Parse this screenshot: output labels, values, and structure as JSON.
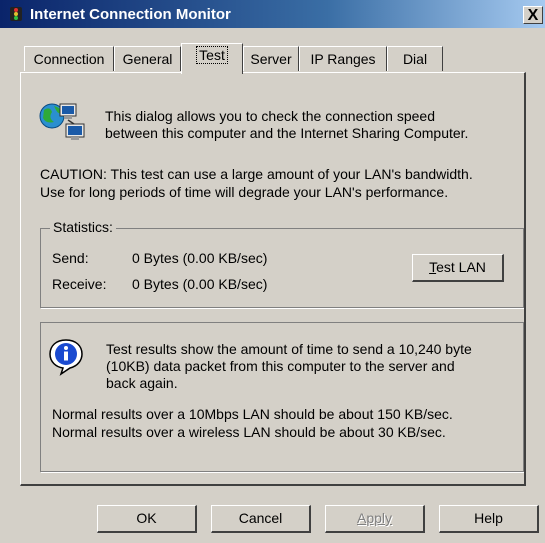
{
  "window": {
    "title": "Internet Connection Monitor",
    "close_glyph": "X"
  },
  "tabs": [
    {
      "label": "Connection",
      "active": false
    },
    {
      "label": "General",
      "active": false
    },
    {
      "label": "Test",
      "active": true
    },
    {
      "label": "Server",
      "active": false
    },
    {
      "label": "IP Ranges",
      "active": false
    },
    {
      "label": "Dial",
      "active": false
    }
  ],
  "intro": {
    "line1": "This dialog allows you to check the connection speed",
    "line2": "between this computer and the Internet Sharing Computer."
  },
  "caution": {
    "line1": "CAUTION: This test can use a large amount of your LAN's bandwidth.",
    "line2": "Use for long periods of time will degrade your LAN's performance."
  },
  "statistics": {
    "legend": "Statistics:",
    "send_label": "Send:",
    "send_value": "0 Bytes (0.00 KB/sec)",
    "receive_label": "Receive:",
    "receive_value": "0 Bytes (0.00 KB/sec)",
    "test_button_mnemonic": "T",
    "test_button_rest": "est LAN"
  },
  "info": {
    "line1": "Test results show the amount of time to send a 10,240 byte",
    "line2": "(10KB) data packet from this computer to the server and",
    "line3": "back again.",
    "normal_wired": "Normal results over a 10Mbps LAN should be about 150 KB/sec.",
    "normal_wireless": "Normal results over a wireless LAN should be about 30 KB/sec."
  },
  "buttons": {
    "ok": "OK",
    "cancel": "Cancel",
    "apply": "Apply",
    "help": "Help"
  },
  "icons": {
    "app": "traffic-light-icon",
    "network": "network-computers-icon",
    "info": "information-icon"
  },
  "colors": {
    "titlebar_start": "#0a246a",
    "titlebar_end": "#a6caf0",
    "face": "#d4d0c8"
  }
}
